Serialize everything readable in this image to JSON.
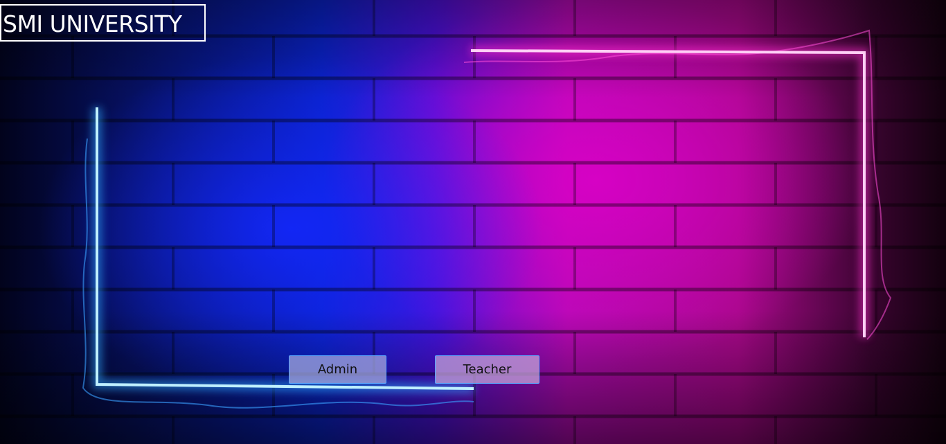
{
  "app": {
    "brand": "SMI UNIVERSITY"
  },
  "actions": {
    "admin_label": "Admin",
    "teacher_label": "Teacher"
  },
  "colors": {
    "neon_blue": "#7fd8ff",
    "neon_pink": "#ff4fd8",
    "button_border": "#5aa8ff"
  }
}
